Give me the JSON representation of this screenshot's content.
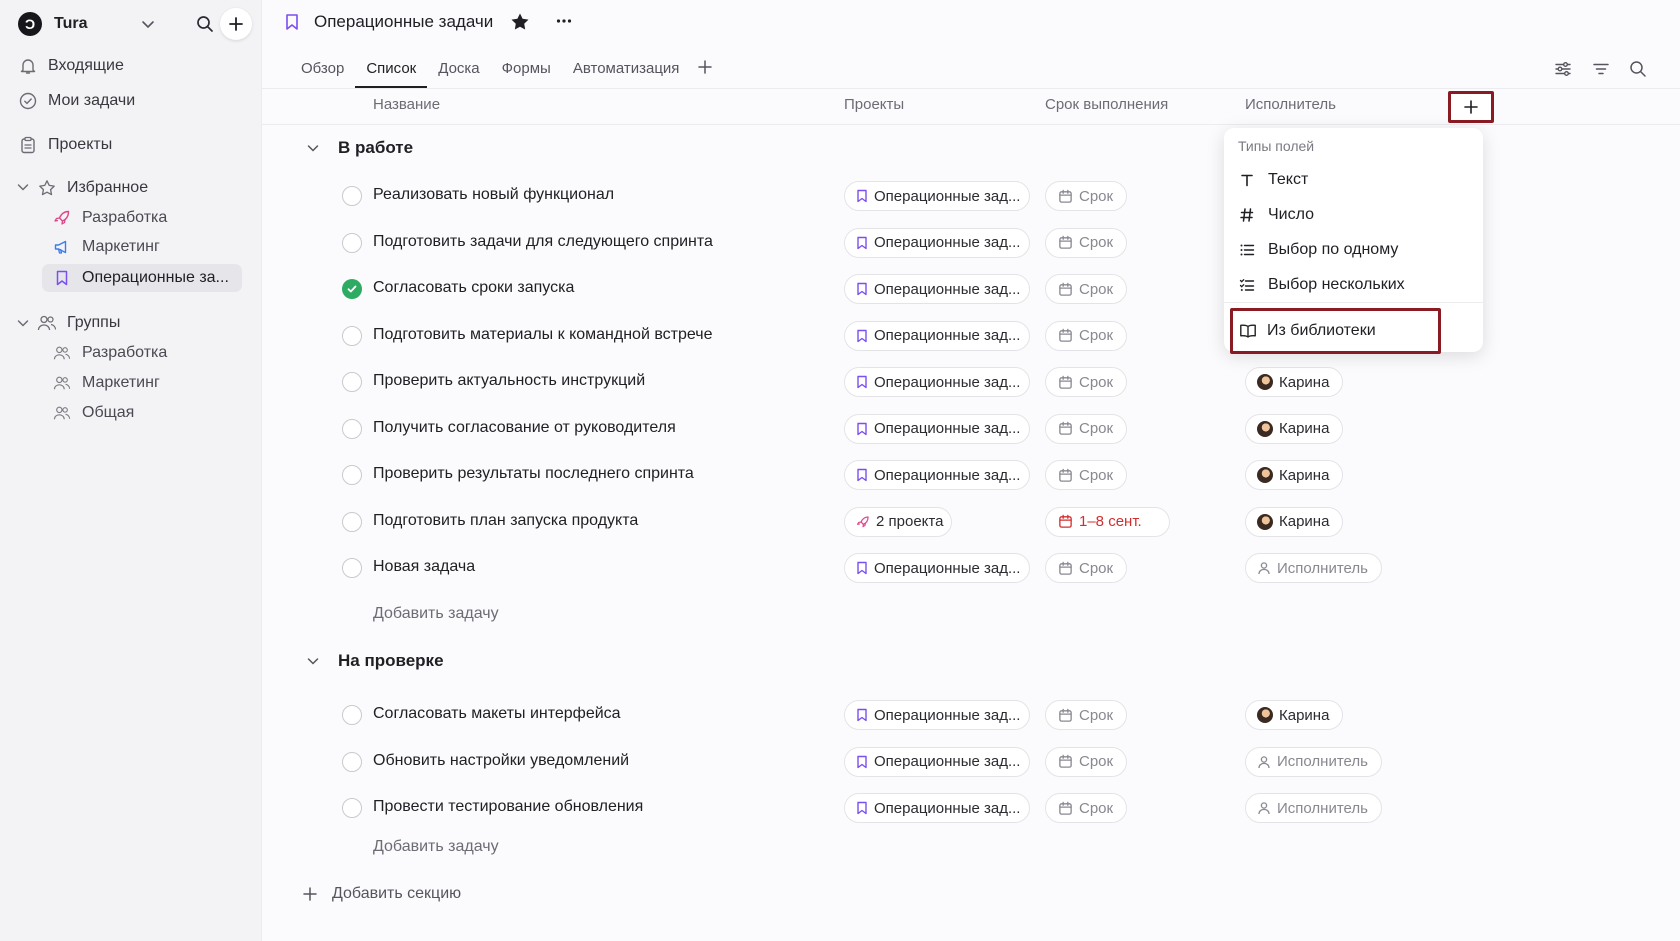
{
  "workspace": {
    "logo": "Ɔ",
    "name": "Tura"
  },
  "nav": {
    "inbox": "Входящие",
    "my_tasks": "Мои задачи",
    "projects": "Проекты"
  },
  "favorites": {
    "label": "Избранное",
    "items": [
      "Разработка",
      "Маркетинг",
      "Операционные за..."
    ]
  },
  "groups": {
    "label": "Группы",
    "items": [
      "Разработка",
      "Маркетинг",
      "Общая"
    ]
  },
  "header": {
    "title": "Операционные задачи",
    "more": "···"
  },
  "tabs": [
    "Обзор",
    "Список",
    "Доска",
    "Формы",
    "Автоматизация"
  ],
  "columns": {
    "name": "Название",
    "projects": "Проекты",
    "due": "Срок выполнения",
    "assignee": "Исполнитель"
  },
  "sections": [
    {
      "title": "В работе",
      "add_task": "Добавить задачу",
      "tasks": [
        {
          "title": "Реализовать новый функционал",
          "done": false,
          "project": "Операционные зад...",
          "due": "Срок",
          "assignee": ""
        },
        {
          "title": "Подготовить задачи для следующего спринта",
          "done": false,
          "project": "Операционные зад...",
          "due": "Срок",
          "assignee": ""
        },
        {
          "title": "Согласовать сроки запуска",
          "done": true,
          "project": "Операционные зад...",
          "due": "Срок",
          "assignee": ""
        },
        {
          "title": "Подготовить материалы к командной встрече",
          "done": false,
          "project": "Операционные зад...",
          "due": "Срок",
          "assignee": ""
        },
        {
          "title": "Проверить актуальность инструкций",
          "done": false,
          "project": "Операционные зад...",
          "due": "Срок",
          "assignee": "Карина"
        },
        {
          "title": "Получить согласование от руководителя",
          "done": false,
          "project": "Операционные зад...",
          "due": "Срок",
          "assignee": "Карина"
        },
        {
          "title": "Проверить результаты последнего спринта",
          "done": false,
          "project": "Операционные зад...",
          "due": "Срок",
          "assignee": "Карина"
        },
        {
          "title": "Подготовить план запуска продукта",
          "done": false,
          "project": "2 проекта",
          "due": "1–8 сент.",
          "assignee": "Карина"
        },
        {
          "title": "Новая задача",
          "done": false,
          "project": "Операционные зад...",
          "due": "Срок",
          "assignee": "Исполнитель"
        }
      ]
    },
    {
      "title": "На проверке",
      "add_task": "Добавить задачу",
      "tasks": [
        {
          "title": "Согласовать макеты интерфейса",
          "done": false,
          "project": "Операционные зад...",
          "due": "Срок",
          "assignee": "Карина"
        },
        {
          "title": "Обновить настройки уведомлений",
          "done": false,
          "project": "Операционные зад...",
          "due": "Срок",
          "assignee": "Исполнитель"
        },
        {
          "title": "Провести тестирование обновления",
          "done": false,
          "project": "Операционные зад...",
          "due": "Срок",
          "assignee": "Исполнитель"
        }
      ]
    }
  ],
  "add_section": "Добавить секцию",
  "dropdown": {
    "header": "Типы полей",
    "items": [
      "Текст",
      "Число",
      "Выбор по одному",
      "Выбор нескольких"
    ],
    "library": "Из библиотеки"
  },
  "colors": {
    "accent": "#7b4ff0",
    "done": "#2eab62",
    "overdue": "#d12f2f",
    "highlight": "#8b1b22"
  }
}
